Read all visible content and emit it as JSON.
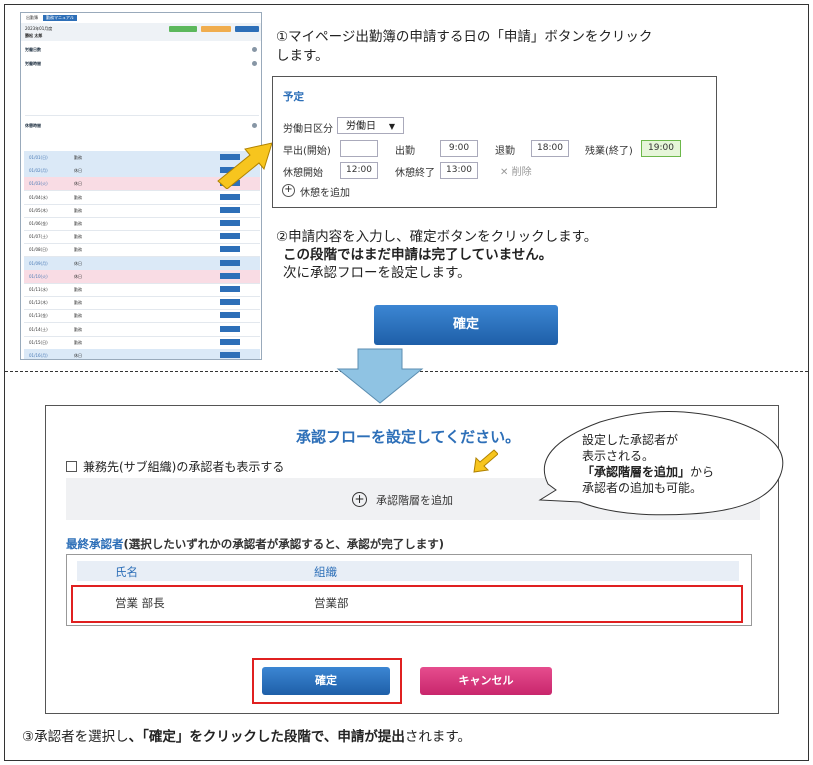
{
  "mini_screenshot": {
    "tabs": [
      "出勤簿",
      "勤務マニュアル"
    ],
    "month": "2023年01月度",
    "user": "勝松 太郎",
    "sections": [
      "労働日数",
      "労働時間",
      "休憩時間"
    ],
    "rows": [
      {
        "date": "01/01(日)",
        "kind": "勤務",
        "style": "blue"
      },
      {
        "date": "01/02(月)",
        "kind": "休日",
        "style": "blue"
      },
      {
        "date": "01/03(火)",
        "kind": "休日",
        "style": "pink"
      },
      {
        "date": "01/04(水)",
        "kind": "勤務",
        "style": ""
      },
      {
        "date": "01/05(木)",
        "kind": "勤務",
        "style": ""
      },
      {
        "date": "01/06(金)",
        "kind": "勤務",
        "style": ""
      },
      {
        "date": "01/07(土)",
        "kind": "勤務",
        "style": ""
      },
      {
        "date": "01/08(日)",
        "kind": "勤務",
        "style": ""
      },
      {
        "date": "01/09(月)",
        "kind": "休日",
        "style": "blue"
      },
      {
        "date": "01/10(火)",
        "kind": "休日",
        "style": "pink"
      },
      {
        "date": "01/11(水)",
        "kind": "勤務",
        "style": ""
      },
      {
        "date": "01/12(木)",
        "kind": "勤務",
        "style": ""
      },
      {
        "date": "01/13(金)",
        "kind": "勤務",
        "style": ""
      },
      {
        "date": "01/14(土)",
        "kind": "勤務",
        "style": ""
      },
      {
        "date": "01/15(日)",
        "kind": "勤務",
        "style": ""
      },
      {
        "date": "01/16(月)",
        "kind": "休日",
        "style": "blue"
      }
    ]
  },
  "step1": {
    "line1": "①マイページ出勤簿の申請する日の「申請」ボタンをクリック",
    "line2": "します。"
  },
  "plan": {
    "title": "予定",
    "workday_label": "労働日区分",
    "workday_value": "労働日",
    "early_label": "早出(開始)",
    "early_value": "",
    "in_label": "出勤",
    "in_value": "9:00",
    "out_label": "退勤",
    "out_value": "18:00",
    "overtime_label": "残業(終了)",
    "overtime_value": "19:00",
    "break_start_label": "休憩開始",
    "break_start_value": "12:00",
    "break_end_label": "休憩終了",
    "break_end_value": "13:00",
    "delete_label": "削除",
    "add_break_label": "休憩を追加"
  },
  "step2": {
    "line1": "②申請内容を入力し、確定ボタンをクリックします。",
    "line2": "この段階ではまだ申請は完了していません。",
    "line3": "次に承認フローを設定します。"
  },
  "confirm1_label": "確定",
  "approval": {
    "title": "承認フローを設定してください。",
    "checkbox_label": "兼務先(サブ組織)の承認者も表示する",
    "add_layer_label": "承認階層を追加",
    "final_highlight": "最終承認者",
    "final_rest": "(選択したいずれかの承認者が承認すると、承認が完了します)",
    "col_name": "氏名",
    "col_org": "組織",
    "row_name": "営業 部長",
    "row_org": "営業部"
  },
  "bubble": {
    "line1": "設定した承認者が",
    "line2": "表示される。",
    "line3_bold": "「承認階層を追加」",
    "line3_rest": "から",
    "line4": "承認者の追加も可能。"
  },
  "confirm2_label": "確定",
  "cancel_label": "キャンセル",
  "step3": {
    "a": "③承認者を選択し",
    "b": "、「確定」をクリックした段階で、申請が提出",
    "c": "されます。"
  }
}
